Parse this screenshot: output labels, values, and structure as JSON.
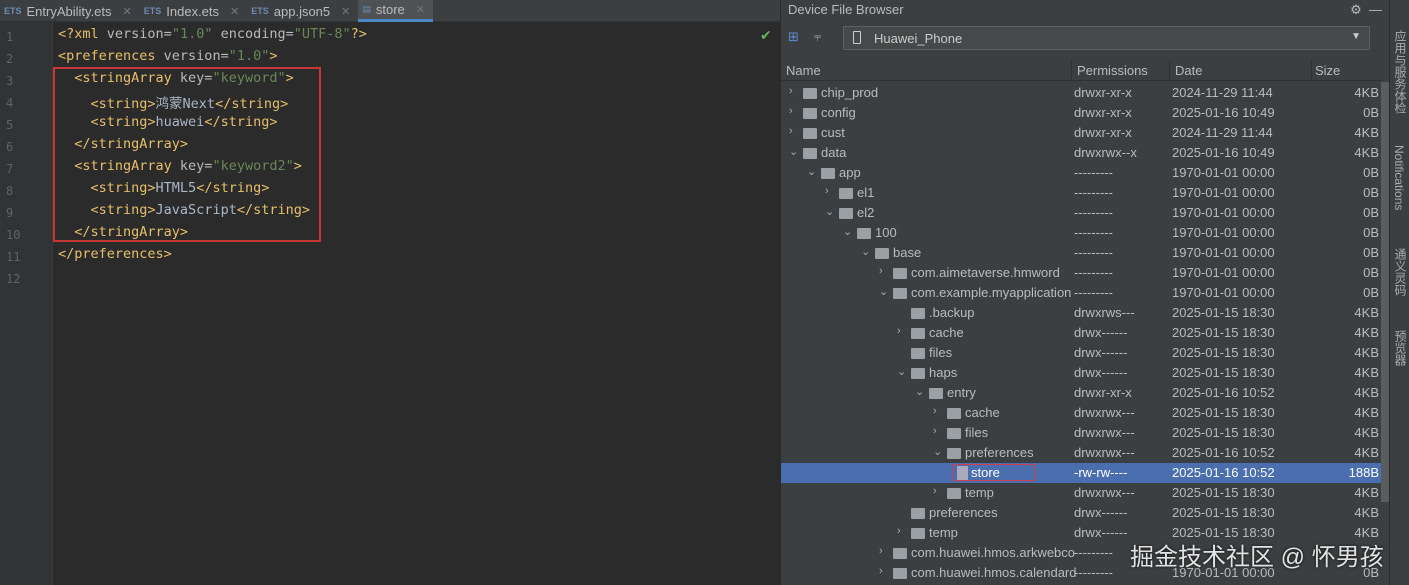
{
  "editor": {
    "tabs": [
      {
        "label": "EntryAbility.ets",
        "icon": "ets-file-icon"
      },
      {
        "label": "Index.ets",
        "icon": "ets-file-icon"
      },
      {
        "label": "app.json5",
        "icon": "json-file-icon"
      },
      {
        "label": "store",
        "icon": "file-icon",
        "active": true
      }
    ],
    "lines": [
      [
        "<?xml ",
        "version=",
        "\"1.0\"",
        " encoding=",
        "\"UTF-8\"",
        "?>"
      ],
      [
        "<preferences ",
        "version=",
        "\"1.0\"",
        ">"
      ],
      [
        "  <stringArray ",
        "key=",
        "\"keyword\"",
        ">"
      ],
      [
        "    <string>",
        "鸿蒙Next",
        "</string>"
      ],
      [
        "    <string>",
        "huawei",
        "</string>"
      ],
      [
        "  </stringArray>"
      ],
      [
        "  <stringArray ",
        "key=",
        "\"keyword2\"",
        ">"
      ],
      [
        "    <string>",
        "HTML5",
        "</string>"
      ],
      [
        "    <string>",
        "JavaScript",
        "</string>"
      ],
      [
        "  </stringArray>"
      ],
      [
        "</preferences>"
      ],
      [
        ""
      ]
    ]
  },
  "device_file_browser": {
    "title": "Device File Browser",
    "device": "Huawei_Phone",
    "columns": [
      "Name",
      "Permissions",
      "Date",
      "Size"
    ],
    "rows": [
      {
        "name": "chip_prod",
        "level": 0,
        "state": "collapsed",
        "perm": "drwxr-xr-x",
        "date": "2024-11-29 11:44",
        "size": "4KB"
      },
      {
        "name": "config",
        "level": 0,
        "state": "collapsed",
        "perm": "drwxr-xr-x",
        "date": "2025-01-16 10:49",
        "size": "0B"
      },
      {
        "name": "cust",
        "level": 0,
        "state": "collapsed",
        "perm": "drwxr-xr-x",
        "date": "2024-11-29 11:44",
        "size": "4KB"
      },
      {
        "name": "data",
        "level": 0,
        "state": "expanded",
        "perm": "drwxrwx--x",
        "date": "2025-01-16 10:49",
        "size": "4KB"
      },
      {
        "name": "app",
        "level": 1,
        "state": "expanded",
        "perm": "---------",
        "date": "1970-01-01 00:00",
        "size": "0B"
      },
      {
        "name": "el1",
        "level": 2,
        "state": "collapsed",
        "perm": "---------",
        "date": "1970-01-01 00:00",
        "size": "0B"
      },
      {
        "name": "el2",
        "level": 2,
        "state": "expanded",
        "perm": "---------",
        "date": "1970-01-01 00:00",
        "size": "0B"
      },
      {
        "name": "100",
        "level": 3,
        "state": "expanded",
        "perm": "---------",
        "date": "1970-01-01 00:00",
        "size": "0B"
      },
      {
        "name": "base",
        "level": 4,
        "state": "expanded",
        "perm": "---------",
        "date": "1970-01-01 00:00",
        "size": "0B"
      },
      {
        "name": "com.aimetaverse.hmword",
        "level": 5,
        "state": "collapsed",
        "perm": "---------",
        "date": "1970-01-01 00:00",
        "size": "0B"
      },
      {
        "name": "com.example.myapplication",
        "level": 5,
        "state": "expanded",
        "perm": "---------",
        "date": "1970-01-01 00:00",
        "size": "0B"
      },
      {
        "name": ".backup",
        "level": 6,
        "state": "leaf",
        "perm": "drwxrws---",
        "date": "2025-01-15 18:30",
        "size": "4KB"
      },
      {
        "name": "cache",
        "level": 6,
        "state": "collapsed",
        "perm": "drwx------",
        "date": "2025-01-15 18:30",
        "size": "4KB"
      },
      {
        "name": "files",
        "level": 6,
        "state": "leaf",
        "perm": "drwx------",
        "date": "2025-01-15 18:30",
        "size": "4KB"
      },
      {
        "name": "haps",
        "level": 6,
        "state": "expanded",
        "perm": "drwx------",
        "date": "2025-01-15 18:30",
        "size": "4KB"
      },
      {
        "name": "entry",
        "level": 7,
        "state": "expanded",
        "perm": "drwxr-xr-x",
        "date": "2025-01-16 10:52",
        "size": "4KB"
      },
      {
        "name": "cache",
        "level": 8,
        "state": "collapsed",
        "perm": "drwxrwx---",
        "date": "2025-01-15 18:30",
        "size": "4KB"
      },
      {
        "name": "files",
        "level": 8,
        "state": "collapsed",
        "perm": "drwxrwx---",
        "date": "2025-01-15 18:30",
        "size": "4KB"
      },
      {
        "name": "preferences",
        "level": 8,
        "state": "expanded",
        "perm": "drwxrwx---",
        "date": "2025-01-16 10:52",
        "size": "4KB"
      },
      {
        "name": "store",
        "level": 9,
        "state": "file",
        "selected": true,
        "perm": "-rw-rw----",
        "date": "2025-01-16 10:52",
        "size": "188B"
      },
      {
        "name": "temp",
        "level": 8,
        "state": "collapsed",
        "perm": "drwxrwx---",
        "date": "2025-01-15 18:30",
        "size": "4KB"
      },
      {
        "name": "preferences",
        "level": 6,
        "state": "leaf",
        "perm": "drwx------",
        "date": "2025-01-15 18:30",
        "size": "4KB"
      },
      {
        "name": "temp",
        "level": 6,
        "state": "collapsed",
        "perm": "drwx------",
        "date": "2025-01-15 18:30",
        "size": "4KB"
      },
      {
        "name": "com.huawei.hmos.arkwebco",
        "level": 5,
        "state": "collapsed",
        "perm": "---------",
        "date": "",
        "size": ""
      },
      {
        "name": "com.huawei.hmos.calendard",
        "level": 5,
        "state": "collapsed",
        "perm": "---------",
        "date": "1970-01-01 00:00",
        "size": "0B"
      }
    ]
  },
  "right_rail": [
    "应用与服务体检",
    "Notifications",
    "通义灵码",
    "预览器"
  ],
  "watermark": "掘金技术社区 @ 怀男孩",
  "colors": {
    "selection": "#4b6eaf",
    "highlight_box": "#c83737",
    "tab_underline": "#4a88c7"
  }
}
